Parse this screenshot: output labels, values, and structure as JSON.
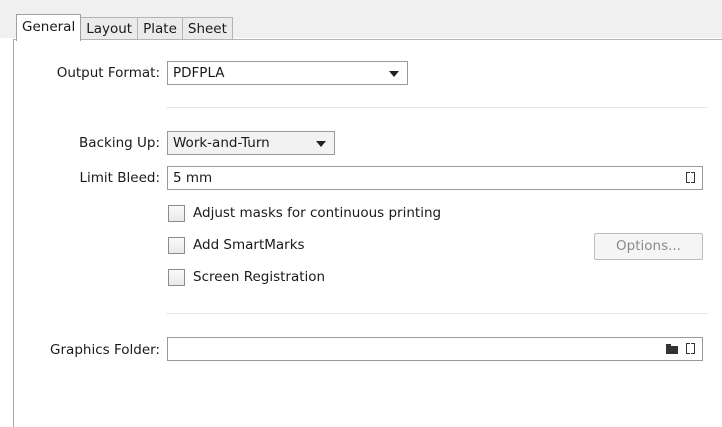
{
  "tabs": [
    "General",
    "Layout",
    "Plate",
    "Sheet"
  ],
  "active_tab": "General",
  "output_format": {
    "label": "Output Format:",
    "value": "PDFPLA"
  },
  "backing_up": {
    "label": "Backing Up:",
    "value": "Work-and-Turn"
  },
  "limit_bleed": {
    "label": "Limit Bleed:",
    "value": "5 mm"
  },
  "checkboxes": [
    {
      "label": "Adjust masks for continuous printing",
      "checked": false
    },
    {
      "label": "Add SmartMarks",
      "checked": false
    },
    {
      "label": "Screen Registration",
      "checked": false
    }
  ],
  "options_button": {
    "label": "Options...",
    "enabled": false
  },
  "graphics_folder": {
    "label": "Graphics Folder:",
    "value": ""
  },
  "icons": {
    "dropdown": "chevron-down-icon",
    "variable": "bracket-icon",
    "folder": "folder-icon"
  }
}
